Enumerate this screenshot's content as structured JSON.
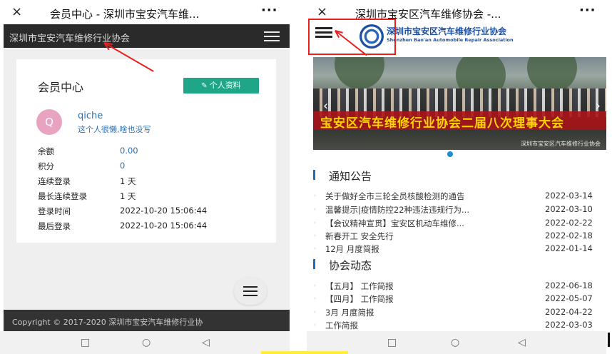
{
  "left": {
    "topbar": {
      "close_icon": "×",
      "title": "会员中心 - 深圳市宝安汽车维...",
      "more": "···"
    },
    "header": {
      "site_name": "深圳市宝安汽车维修行业协会"
    },
    "card": {
      "title": "会员中心",
      "profile_button": "个人资料",
      "avatar_letter": "Q",
      "username": "qiche",
      "signature": "这个人很懒,啥也没写",
      "rows": [
        {
          "label": "余额",
          "value": "0.00"
        },
        {
          "label": "积分",
          "value": "0"
        },
        {
          "label": "连续登录",
          "value": "1 天"
        },
        {
          "label": "最长连续登录",
          "value": "1 天"
        },
        {
          "label": "登录时间",
          "value": "2022-10-20 15:06:44"
        },
        {
          "label": "最后登录",
          "value": "2022-10-20 15:06:44"
        }
      ]
    },
    "footer": {
      "copyright": "Copyright © 2017-2020 深圳市宝安汽车维修行业协"
    }
  },
  "right": {
    "topbar": {
      "close_icon": "×",
      "title": "深圳市宝安区汽车维修协会 -...",
      "more": "···"
    },
    "logo": {
      "cn": "深圳市宝安区汽车维修行业协会",
      "en": "Shenzhen Bao'an Automobile Repair Association"
    },
    "banner": {
      "caption": "宝安区汽车维修行业协会二届八次理事大会",
      "watermark": "深圳市宝安区汽车维修行业协会"
    },
    "notices": {
      "heading": "通知公告",
      "items": [
        {
          "title": "关于做好全市三轮全员核酸检测的通告",
          "date": "2022-03-14"
        },
        {
          "title": "温馨提示|疫情防控22种违法违规行为...",
          "date": "2022-03-10"
        },
        {
          "title": "【会议精神宣贯】宝安区机动车维修...",
          "date": "2022-02-22"
        },
        {
          "title": "新春开工 安全先行",
          "date": "2022-02-18"
        },
        {
          "title": "12月 月度简报",
          "date": "2022-01-14"
        }
      ]
    },
    "news": {
      "heading": "协会动态",
      "items": [
        {
          "title": "【五月】 工作简报",
          "date": "2022-06-18"
        },
        {
          "title": "【四月】 工作简报",
          "date": "2022-05-07"
        },
        {
          "title": "3月 月度简报",
          "date": "2022-04-22"
        },
        {
          "title": "工作简报",
          "date": "2022-03-03"
        }
      ]
    }
  },
  "navbar": {
    "recent": "□",
    "home": "○",
    "back": "◁"
  },
  "colors": {
    "accent_green": "#1fa587",
    "link_blue": "#2b6fb3",
    "annotation_red": "#e82020",
    "banner_red": "#a81418",
    "banner_text": "#ffd400"
  }
}
